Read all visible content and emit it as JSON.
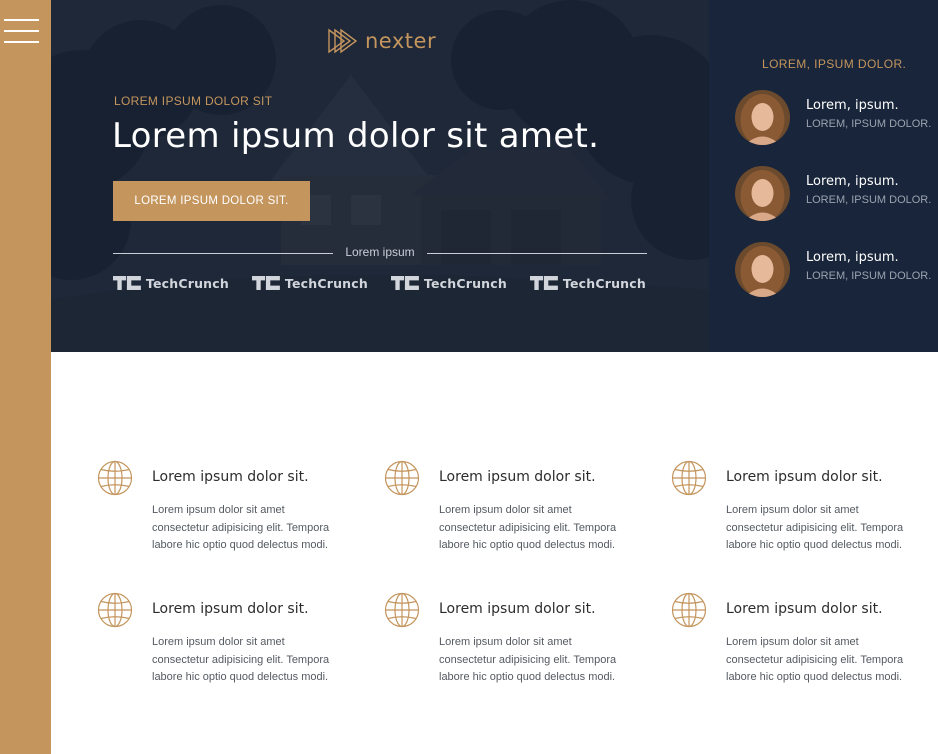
{
  "brand": {
    "name": "nexter",
    "accent": "#c4955d",
    "dark": "#18253a"
  },
  "nav": {
    "menu_icon": "hamburger-menu-icon"
  },
  "hero": {
    "eyebrow": "LOREM IPSUM DOLOR SIT",
    "headline": "Lorem ipsum dolor sit amet.",
    "cta_label": "LOREM IPSUM DOLOR SIT.",
    "divider_label": "Lorem ipsum",
    "press": [
      {
        "name": "TechCrunch"
      },
      {
        "name": "TechCrunch"
      },
      {
        "name": "TechCrunch"
      },
      {
        "name": "TechCrunch"
      }
    ]
  },
  "realtors": {
    "title": "LOREM, IPSUM DOLOR.",
    "items": [
      {
        "name": "Lorem, ipsum.",
        "role": "LOREM, IPSUM DOLOR."
      },
      {
        "name": "Lorem, ipsum.",
        "role": "LOREM, IPSUM DOLOR."
      },
      {
        "name": "Lorem, ipsum.",
        "role": "LOREM, IPSUM DOLOR."
      }
    ]
  },
  "features": [
    {
      "icon": "globe-icon",
      "title": "Lorem ipsum dolor sit.",
      "text": "Lorem ipsum dolor sit amet consectetur adipisicing elit. Tempora labore hic optio quod delectus modi."
    },
    {
      "icon": "globe-icon",
      "title": "Lorem ipsum dolor sit.",
      "text": "Lorem ipsum dolor sit amet consectetur adipisicing elit. Tempora labore hic optio quod delectus modi."
    },
    {
      "icon": "globe-icon",
      "title": "Lorem ipsum dolor sit.",
      "text": "Lorem ipsum dolor sit amet consectetur adipisicing elit. Tempora labore hic optio quod delectus modi."
    },
    {
      "icon": "globe-icon",
      "title": "Lorem ipsum dolor sit.",
      "text": "Lorem ipsum dolor sit amet consectetur adipisicing elit. Tempora labore hic optio quod delectus modi."
    },
    {
      "icon": "globe-icon",
      "title": "Lorem ipsum dolor sit.",
      "text": "Lorem ipsum dolor sit amet consectetur adipisicing elit. Tempora labore hic optio quod delectus modi."
    },
    {
      "icon": "globe-icon",
      "title": "Lorem ipsum dolor sit.",
      "text": "Lorem ipsum dolor sit amet consectetur adipisicing elit. Tempora labore hic optio quod delectus modi."
    }
  ]
}
